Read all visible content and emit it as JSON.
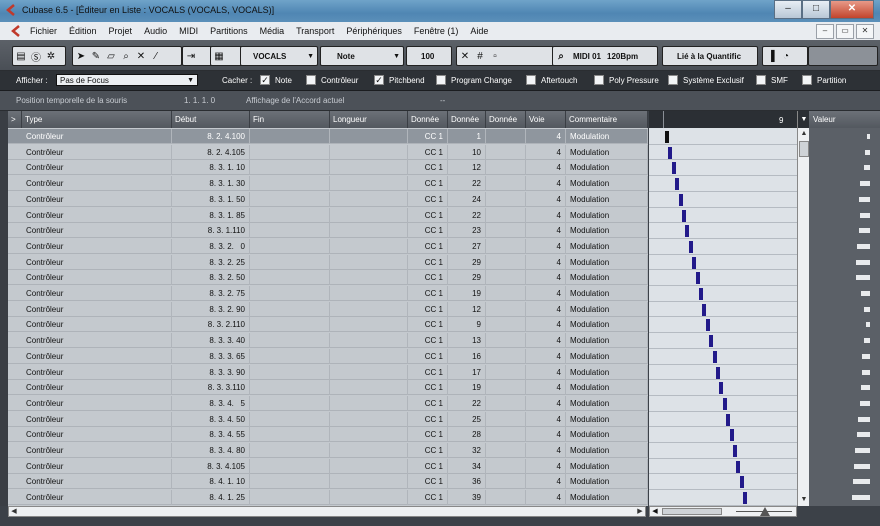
{
  "window": {
    "title": "Cubase 6.5 - [Éditeur en Liste : VOCALS (VOCALS, VOCALS)]",
    "controls": {
      "minimize": "–",
      "maximize": "□",
      "close": "✕"
    }
  },
  "menu": {
    "items": [
      "Fichier",
      "Édition",
      "Projet",
      "Audio",
      "MIDI",
      "Partitions",
      "Média",
      "Transport",
      "Périphériques",
      "Fenêtre (1)",
      "Aide"
    ],
    "right": [
      "–",
      "▭",
      "✕"
    ]
  },
  "toolbar": {
    "track": "VOCALS",
    "insert_type": "Note",
    "volume": "100",
    "midi_output": "MIDI 01",
    "tempo": "120Bpm",
    "quantize": "Lié à la Quantific"
  },
  "filterbar": {
    "show_label": "Afficher :",
    "focus_value": "Pas de Focus",
    "hide_label": "Cacher :",
    "checks": [
      {
        "label": "Note",
        "checked": true
      },
      {
        "label": "Contrôleur",
        "checked": false
      },
      {
        "label": "Pitchbend",
        "checked": true
      },
      {
        "label": "Program Change",
        "checked": false
      },
      {
        "label": "Aftertouch",
        "checked": false
      },
      {
        "label": "Poly Pressure",
        "checked": false
      },
      {
        "label": "Système Exclusif",
        "checked": false
      },
      {
        "label": "SMF",
        "checked": false
      },
      {
        "label": "Partition",
        "checked": false
      }
    ]
  },
  "infobar": {
    "mouse_label": "Position temporelle de la souris",
    "mouse_value": "1. 1. 1.   0",
    "chord_label": "Affichage de l'Accord actuel",
    "chord_value": "--"
  },
  "columns": [
    "Type",
    "Début",
    "Fin",
    "Longueur",
    "Donnée",
    "Donnée",
    "Donnée",
    "Voie",
    "Commentaire"
  ],
  "graph_ruler": "9",
  "value_header": "Valeur",
  "rows": [
    {
      "type": "Contrôleur",
      "start": "8. 2. 4.100",
      "d1": "CC 1",
      "d2": "1",
      "ch": "4",
      "comment": "Modulation",
      "selected": true,
      "value": 1
    },
    {
      "type": "Contrôleur",
      "start": "8. 2. 4.105",
      "d1": "CC 1",
      "d2": "10",
      "ch": "4",
      "comment": "Modulation",
      "value": 10
    },
    {
      "type": "Contrôleur",
      "start": "8. 3. 1. 10",
      "d1": "CC 1",
      "d2": "12",
      "ch": "4",
      "comment": "Modulation",
      "value": 12
    },
    {
      "type": "Contrôleur",
      "start": "8. 3. 1. 30",
      "d1": "CC 1",
      "d2": "22",
      "ch": "4",
      "comment": "Modulation",
      "value": 22
    },
    {
      "type": "Contrôleur",
      "start": "8. 3. 1. 50",
      "d1": "CC 1",
      "d2": "24",
      "ch": "4",
      "comment": "Modulation",
      "value": 24
    },
    {
      "type": "Contrôleur",
      "start": "8. 3. 1. 85",
      "d1": "CC 1",
      "d2": "22",
      "ch": "4",
      "comment": "Modulation",
      "value": 22
    },
    {
      "type": "Contrôleur",
      "start": "8. 3. 1.110",
      "d1": "CC 1",
      "d2": "23",
      "ch": "4",
      "comment": "Modulation",
      "value": 23
    },
    {
      "type": "Contrôleur",
      "start": "8. 3. 2.   0",
      "d1": "CC 1",
      "d2": "27",
      "ch": "4",
      "comment": "Modulation",
      "value": 27
    },
    {
      "type": "Contrôleur",
      "start": "8. 3. 2. 25",
      "d1": "CC 1",
      "d2": "29",
      "ch": "4",
      "comment": "Modulation",
      "value": 29
    },
    {
      "type": "Contrôleur",
      "start": "8. 3. 2. 50",
      "d1": "CC 1",
      "d2": "29",
      "ch": "4",
      "comment": "Modulation",
      "value": 29
    },
    {
      "type": "Contrôleur",
      "start": "8. 3. 2. 75",
      "d1": "CC 1",
      "d2": "19",
      "ch": "4",
      "comment": "Modulation",
      "value": 19
    },
    {
      "type": "Contrôleur",
      "start": "8. 3. 2. 90",
      "d1": "CC 1",
      "d2": "12",
      "ch": "4",
      "comment": "Modulation",
      "value": 12
    },
    {
      "type": "Contrôleur",
      "start": "8. 3. 2.110",
      "d1": "CC 1",
      "d2": "9",
      "ch": "4",
      "comment": "Modulation",
      "value": 9
    },
    {
      "type": "Contrôleur",
      "start": "8. 3. 3. 40",
      "d1": "CC 1",
      "d2": "13",
      "ch": "4",
      "comment": "Modulation",
      "value": 13
    },
    {
      "type": "Contrôleur",
      "start": "8. 3. 3. 65",
      "d1": "CC 1",
      "d2": "16",
      "ch": "4",
      "comment": "Modulation",
      "value": 16
    },
    {
      "type": "Contrôleur",
      "start": "8. 3. 3. 90",
      "d1": "CC 1",
      "d2": "17",
      "ch": "4",
      "comment": "Modulation",
      "value": 17
    },
    {
      "type": "Contrôleur",
      "start": "8. 3. 3.110",
      "d1": "CC 1",
      "d2": "19",
      "ch": "4",
      "comment": "Modulation",
      "value": 19
    },
    {
      "type": "Contrôleur",
      "start": "8. 3. 4.   5",
      "d1": "CC 1",
      "d2": "22",
      "ch": "4",
      "comment": "Modulation",
      "value": 22
    },
    {
      "type": "Contrôleur",
      "start": "8. 3. 4. 50",
      "d1": "CC 1",
      "d2": "25",
      "ch": "4",
      "comment": "Modulation",
      "value": 25
    },
    {
      "type": "Contrôleur",
      "start": "8. 3. 4. 55",
      "d1": "CC 1",
      "d2": "28",
      "ch": "4",
      "comment": "Modulation",
      "value": 28
    },
    {
      "type": "Contrôleur",
      "start": "8. 3. 4. 80",
      "d1": "CC 1",
      "d2": "32",
      "ch": "4",
      "comment": "Modulation",
      "value": 32
    },
    {
      "type": "Contrôleur",
      "start": "8. 3. 4.105",
      "d1": "CC 1",
      "d2": "34",
      "ch": "4",
      "comment": "Modulation",
      "value": 34
    },
    {
      "type": "Contrôleur",
      "start": "8. 4. 1. 10",
      "d1": "CC 1",
      "d2": "36",
      "ch": "4",
      "comment": "Modulation",
      "value": 36
    },
    {
      "type": "Contrôleur",
      "start": "8. 4. 1. 25",
      "d1": "CC 1",
      "d2": "39",
      "ch": "4",
      "comment": "Modulation",
      "value": 39
    }
  ]
}
